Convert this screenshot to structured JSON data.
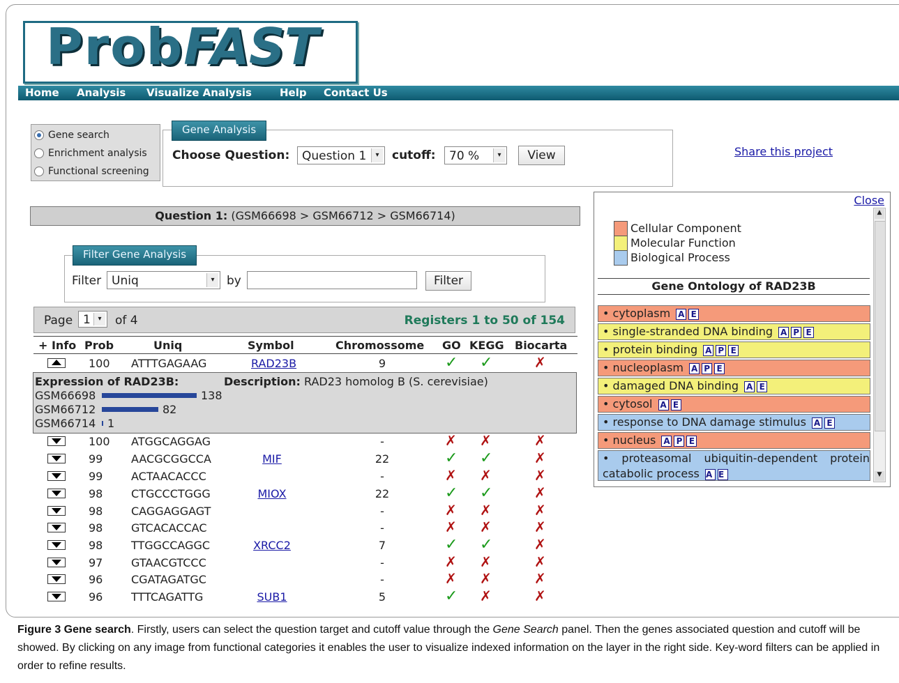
{
  "logo": {
    "prefix": "Prob",
    "suffix": "FAST"
  },
  "nav": [
    "Home",
    "Analysis",
    "Visualize Analysis",
    "Help",
    "Contact Us"
  ],
  "mode": {
    "options": [
      "Gene search",
      "Enrichment analysis",
      "Functional screening"
    ],
    "selected": "Gene search"
  },
  "gene_analysis": {
    "legend": "Gene Analysis",
    "choose_label": "Choose Question:",
    "question_value": "Question 1",
    "cutoff_label": "cutoff:",
    "cutoff_value": "70 %",
    "view_label": "View"
  },
  "share_link": "Share this project",
  "question": {
    "label": "Question 1:",
    "text": "(GSM66698 > GSM66712 > GSM66714)"
  },
  "filter": {
    "legend": "Filter Gene Analysis",
    "label": "Filter",
    "field_value": "Uniq",
    "by_label": "by",
    "input_value": "",
    "button": "Filter"
  },
  "paging": {
    "page_label": "Page",
    "page_value": "1",
    "of_label": "of 4",
    "registers": "Registers 1 to 50 of 154"
  },
  "columns": [
    "+ Info",
    "Prob",
    "Uniq",
    "Symbol",
    "Chromossome",
    "GO",
    "KEGG",
    "Biocarta"
  ],
  "rows": [
    {
      "prob": "100",
      "uniq": "ATTTGAGAAG",
      "symbol": "RAD23B",
      "chrom": "9",
      "go": "✓",
      "kegg": "✓",
      "biocarta": "✗",
      "expanded": true
    },
    {
      "prob": "100",
      "uniq": "ATGGCAGGAG",
      "symbol": "",
      "chrom": "-",
      "go": "✗",
      "kegg": "✗",
      "biocarta": "✗"
    },
    {
      "prob": "99",
      "uniq": "AACGCGGCCA",
      "symbol": "MIF",
      "chrom": "22",
      "go": "✓",
      "kegg": "✓",
      "biocarta": "✗"
    },
    {
      "prob": "99",
      "uniq": "ACTAACACCC",
      "symbol": "",
      "chrom": "-",
      "go": "✗",
      "kegg": "✗",
      "biocarta": "✗"
    },
    {
      "prob": "98",
      "uniq": "CTGCCCTGGG",
      "symbol": "MIOX",
      "chrom": "22",
      "go": "✓",
      "kegg": "✓",
      "biocarta": "✗"
    },
    {
      "prob": "98",
      "uniq": "CAGGAGGAGT",
      "symbol": "",
      "chrom": "-",
      "go": "✗",
      "kegg": "✗",
      "biocarta": "✗"
    },
    {
      "prob": "98",
      "uniq": "GTCACACCAC",
      "symbol": "",
      "chrom": "-",
      "go": "✗",
      "kegg": "✗",
      "biocarta": "✗"
    },
    {
      "prob": "98",
      "uniq": "TTGGCCAGGC",
      "symbol": "XRCC2",
      "chrom": "7",
      "go": "✓",
      "kegg": "✓",
      "biocarta": "✗"
    },
    {
      "prob": "97",
      "uniq": "GTAACGTCCC",
      "symbol": "",
      "chrom": "-",
      "go": "✗",
      "kegg": "✗",
      "biocarta": "✗"
    },
    {
      "prob": "96",
      "uniq": "CGATAGATGC",
      "symbol": "",
      "chrom": "-",
      "go": "✗",
      "kegg": "✗",
      "biocarta": "✗"
    },
    {
      "prob": "96",
      "uniq": "TTTCAGATTG",
      "symbol": "SUB1",
      "chrom": "5",
      "go": "✓",
      "kegg": "✗",
      "biocarta": "✗"
    }
  ],
  "expression": {
    "title": "Expression of RAD23B:",
    "desc_label": "Description:",
    "desc": "RAD23 homolog B (S. cerevisiae)",
    "samples": [
      {
        "name": "GSM66698",
        "value": 138
      },
      {
        "name": "GSM66712",
        "value": 82
      },
      {
        "name": "GSM66714",
        "value": 1
      }
    ]
  },
  "go_panel": {
    "close": "Close",
    "legend": [
      {
        "label": "Cellular Component",
        "color": "#f59a7a"
      },
      {
        "label": "Molecular Function",
        "color": "#f3f07a"
      },
      {
        "label": "Biological Process",
        "color": "#a9cbed"
      }
    ],
    "title": "Gene Ontology of RAD23B",
    "items": [
      {
        "text": "cytoplasm",
        "badges": [
          "A",
          "E"
        ],
        "cat": 0
      },
      {
        "text": "single-stranded DNA binding",
        "badges": [
          "A",
          "P",
          "E"
        ],
        "cat": 1
      },
      {
        "text": "protein binding",
        "badges": [
          "A",
          "P",
          "E"
        ],
        "cat": 1
      },
      {
        "text": "nucleoplasm",
        "badges": [
          "A",
          "P",
          "E"
        ],
        "cat": 0
      },
      {
        "text": "damaged DNA binding",
        "badges": [
          "A",
          "E"
        ],
        "cat": 1
      },
      {
        "text": "cytosol",
        "badges": [
          "A",
          "E"
        ],
        "cat": 0
      },
      {
        "text": "response to DNA damage stimulus",
        "badges": [
          "A",
          "E"
        ],
        "cat": 2
      },
      {
        "text": "nucleus",
        "badges": [
          "A",
          "P",
          "E"
        ],
        "cat": 0
      },
      {
        "text": "proteasomal ubiquitin-dependent protein catabolic process",
        "badges": [
          "A",
          "E"
        ],
        "cat": 2
      }
    ]
  },
  "caption": {
    "label": "Figure 3 Gene search",
    "t1": ". Firstly, users can select the question target and cutoff value through the ",
    "em": "Gene Search",
    "t2": " panel. Then the genes associated question and cutoff will be showed. By clicking on any image from functional categories it enables the user to visualize indexed information on the layer in the right side. Key-word filters can be applied in order to refine results."
  },
  "colors": {
    "nav": "#0e5a70",
    "link": "#1a1aa6",
    "registers": "#1f7a5a",
    "bar": "#27479a"
  }
}
